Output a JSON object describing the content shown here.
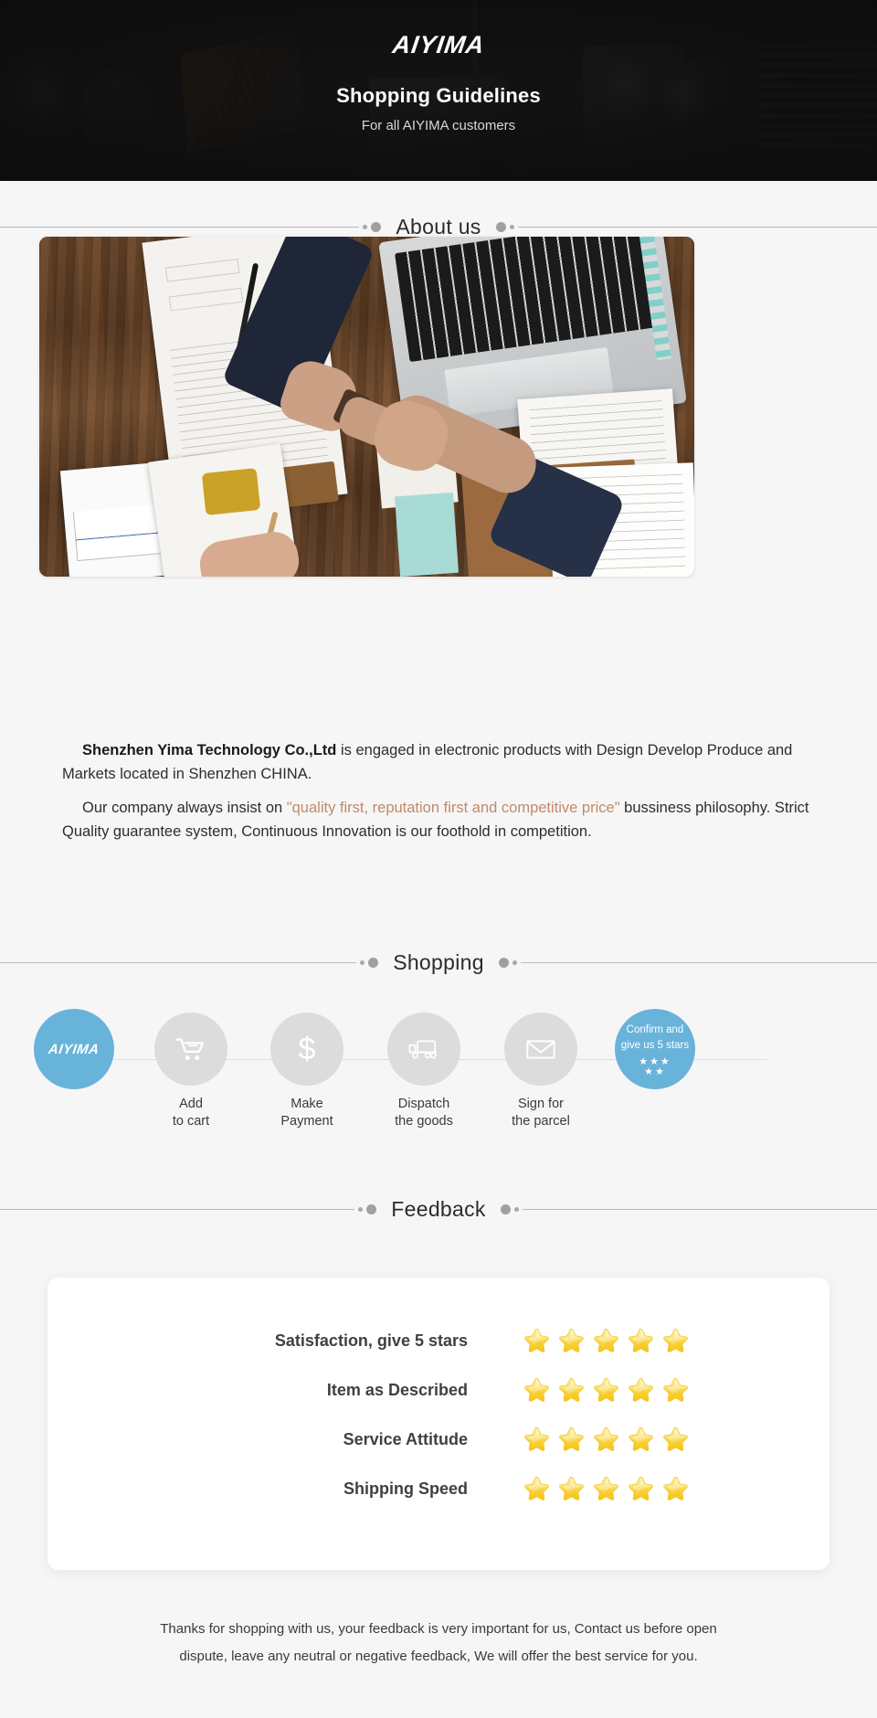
{
  "banner": {
    "logo": "AIYIMA",
    "title": "Shopping Guidelines",
    "subtitle": "For all AIYIMA customers"
  },
  "sections": {
    "about": {
      "title": "About us"
    },
    "shopping": {
      "title": "Shopping"
    },
    "feedback": {
      "title": "Feedback"
    }
  },
  "about": {
    "paragraph1_bold": "Shenzhen Yima Technology Co.,Ltd",
    "paragraph1_rest": " is engaged in electronic products with Design Develop Produce and Markets located in Shenzhen CHINA.",
    "paragraph2_pre": "Our company always insist on ",
    "paragraph2_quote": "\"quality first, reputation first and competitive price\"",
    "paragraph2_post": " bussiness philosophy. Strict Quality guarantee system, Continuous Innovation is our foothold in competition."
  },
  "shopping_steps": [
    {
      "icon": "aiyima-logo-icon",
      "brand": "AIYIMA",
      "label_line1": "",
      "label_line2": "",
      "highlight": true
    },
    {
      "icon": "shopping-cart-icon",
      "label_line1": "Add",
      "label_line2": "to cart",
      "highlight": false
    },
    {
      "icon": "dollar-sign-icon",
      "label_line1": "Make",
      "label_line2": "Payment",
      "highlight": false
    },
    {
      "icon": "delivery-truck-icon",
      "label_line1": "Dispatch",
      "label_line2": "the goods",
      "highlight": false
    },
    {
      "icon": "envelope-icon",
      "label_line1": "Sign for",
      "label_line2": "the parcel",
      "highlight": false
    },
    {
      "icon": "five-stars-icon",
      "confirm_line1": "Confirm and",
      "confirm_line2": "give us 5 stars",
      "stars_top": "★★★",
      "stars_bottom": "★★",
      "highlight": true
    }
  ],
  "feedback_rows": [
    {
      "label": "Satisfaction, give 5 stars",
      "stars": 5
    },
    {
      "label": "Item as Described",
      "stars": 5
    },
    {
      "label": "Service Attitude",
      "stars": 5
    },
    {
      "label": "Shipping Speed",
      "stars": 5
    }
  ],
  "footer": {
    "line1": "Thanks for shopping with us, your feedback is very important for us, Contact us before open",
    "line2": "dispute, leave any neutral or negative feedback, We will offer the best service for you."
  },
  "colors": {
    "accent_blue": "#68b3da",
    "quote_orange": "#c08a6a",
    "banner_bg": "#161616",
    "page_bg": "#f6f6f6",
    "star_gold": "#f6d042"
  }
}
